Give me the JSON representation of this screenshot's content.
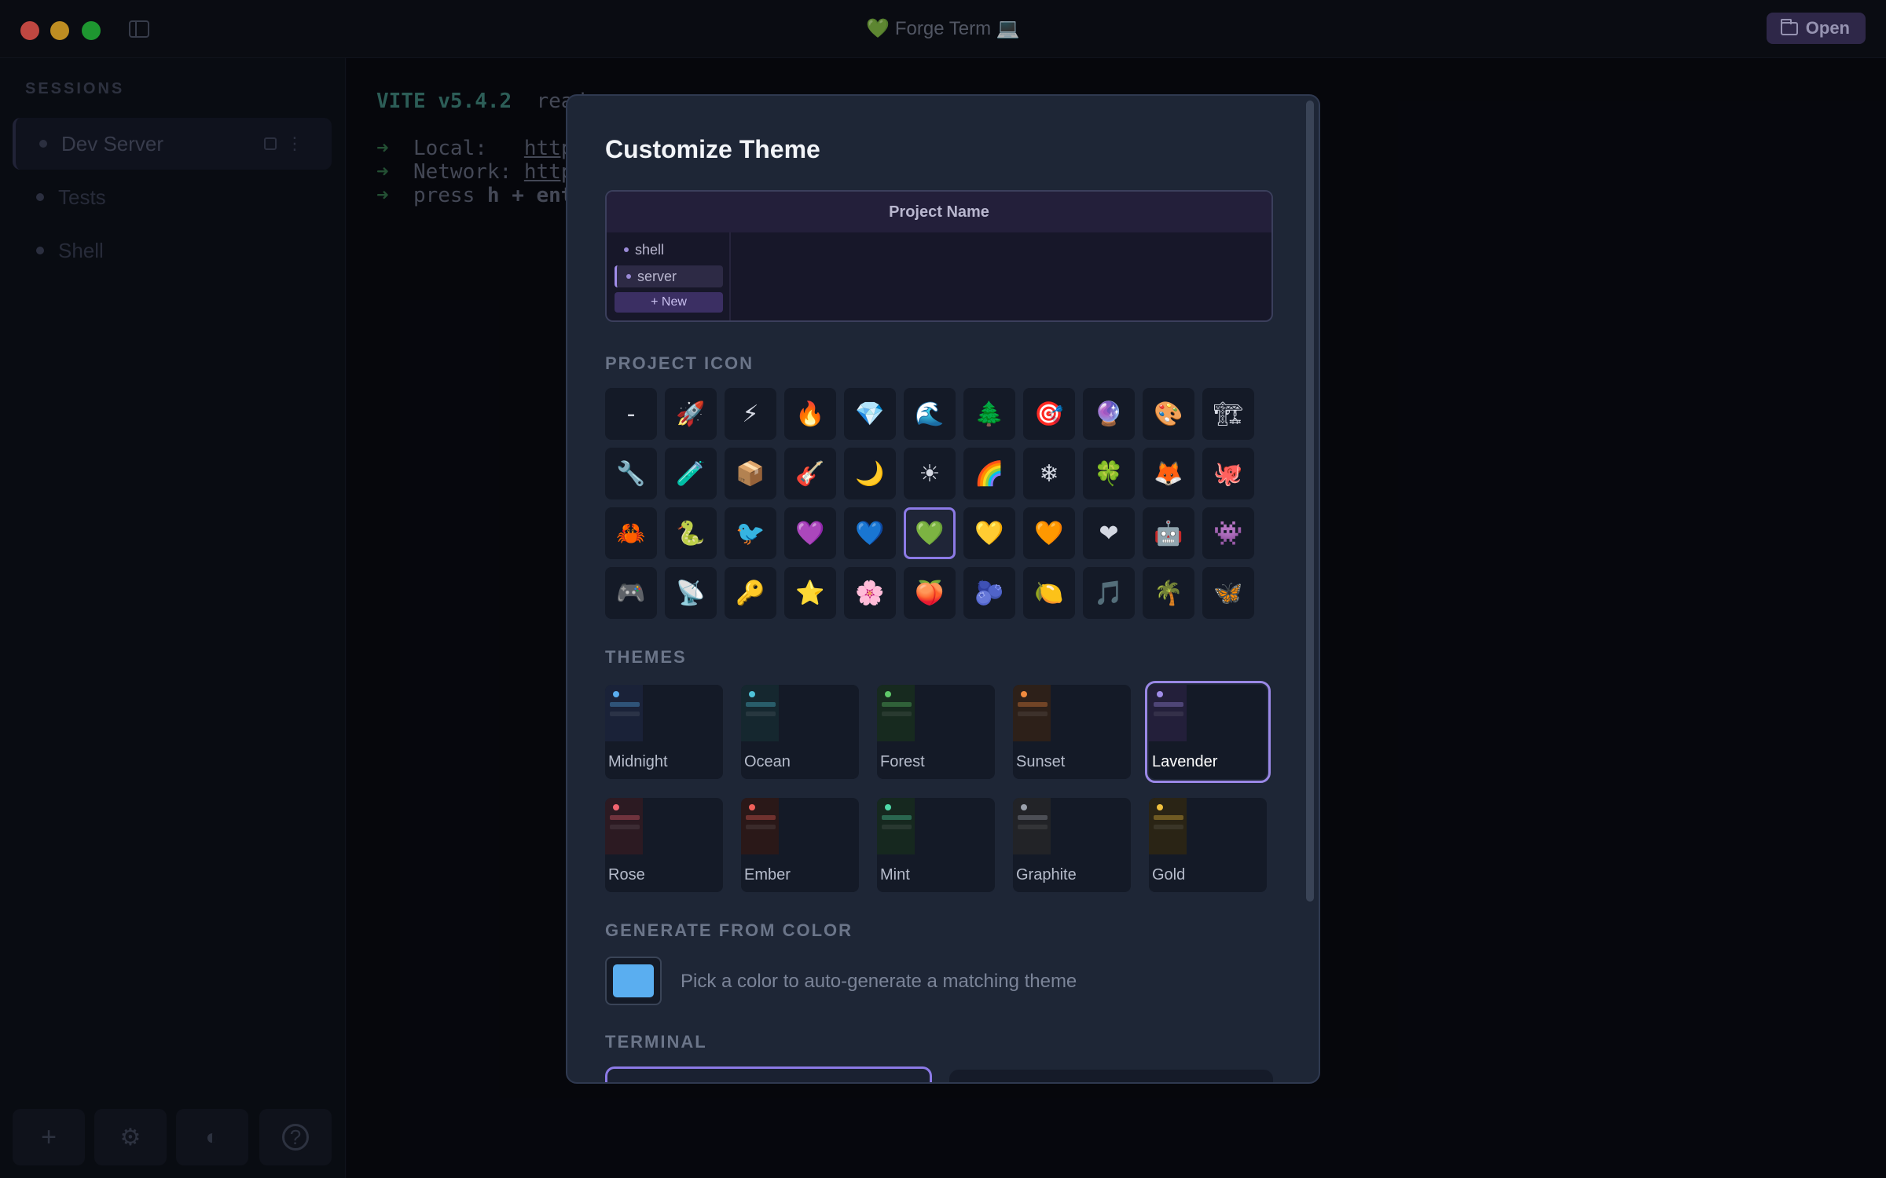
{
  "window": {
    "title": "💚 Forge Term 💻",
    "open_label": "Open"
  },
  "sidebar": {
    "title": "SESSIONS",
    "items": [
      {
        "label": "Dev Server",
        "active": true
      },
      {
        "label": "Tests",
        "active": false
      },
      {
        "label": "Shell",
        "active": false
      }
    ],
    "bottom_buttons": [
      "plus-icon",
      "gear-icon",
      "palette-icon",
      "help-icon"
    ]
  },
  "terminal": {
    "vite": "VITE v5.4.2",
    "ready": "  read",
    "local_label": "Local:   ",
    "local_url": "http",
    "network_label": "Network: ",
    "network_url": "http",
    "press": "press ",
    "press_key": "h + ent"
  },
  "modal": {
    "title": "Customize Theme",
    "preview": {
      "project_name": "Project Name",
      "items": [
        "shell",
        "server"
      ],
      "new_label": "+ New"
    },
    "icon_section": "PROJECT ICON",
    "icons": [
      "-",
      "🚀",
      "⚡",
      "🔥",
      "💎",
      "🌊",
      "🌲",
      "🎯",
      "🔮",
      "🎨",
      "🏗",
      "🔧",
      "🧪",
      "📦",
      "🎸",
      "🌙",
      "☀",
      "🌈",
      "❄",
      "🍀",
      "🦊",
      "🐙",
      "🦀",
      "🐍",
      "🐦",
      "💜",
      "💙",
      "💚",
      "💛",
      "🧡",
      "❤",
      "🤖",
      "👾",
      "🎮",
      "📡",
      "🔑",
      "⭐",
      "🌸",
      "🍑",
      "🫐",
      "🍋",
      "🎵",
      "🌴",
      "🦋"
    ],
    "selected_icon": "💚",
    "themes_section": "THEMES",
    "themes": [
      {
        "name": "Midnight",
        "accent": "#5aaef0",
        "strip": "#1a2238",
        "selected": false
      },
      {
        "name": "Ocean",
        "accent": "#4fc3d9",
        "strip": "#15272f",
        "selected": false
      },
      {
        "name": "Forest",
        "accent": "#5fc86a",
        "strip": "#172a1f",
        "selected": false
      },
      {
        "name": "Sunset",
        "accent": "#f08a3e",
        "strip": "#2d2019",
        "selected": false
      },
      {
        "name": "Lavender",
        "accent": "#a08ce8",
        "strip": "#231f3a",
        "selected": true
      },
      {
        "name": "Rose",
        "accent": "#f06470",
        "strip": "#2c1a22",
        "selected": false
      },
      {
        "name": "Ember",
        "accent": "#f0605a",
        "strip": "#2a1818",
        "selected": false
      },
      {
        "name": "Mint",
        "accent": "#4fd9a8",
        "strip": "#16281f",
        "selected": false
      },
      {
        "name": "Graphite",
        "accent": "#9aa0ab",
        "strip": "#222327",
        "selected": false
      },
      {
        "name": "Gold",
        "accent": "#f0c03e",
        "strip": "#2a2415",
        "selected": false
      }
    ],
    "generate_section": "GENERATE FROM COLOR",
    "generate_text": "Pick a color to auto-generate a matching theme",
    "swatch_color": "#5aaef0",
    "terminal_section": "TERMINAL"
  }
}
